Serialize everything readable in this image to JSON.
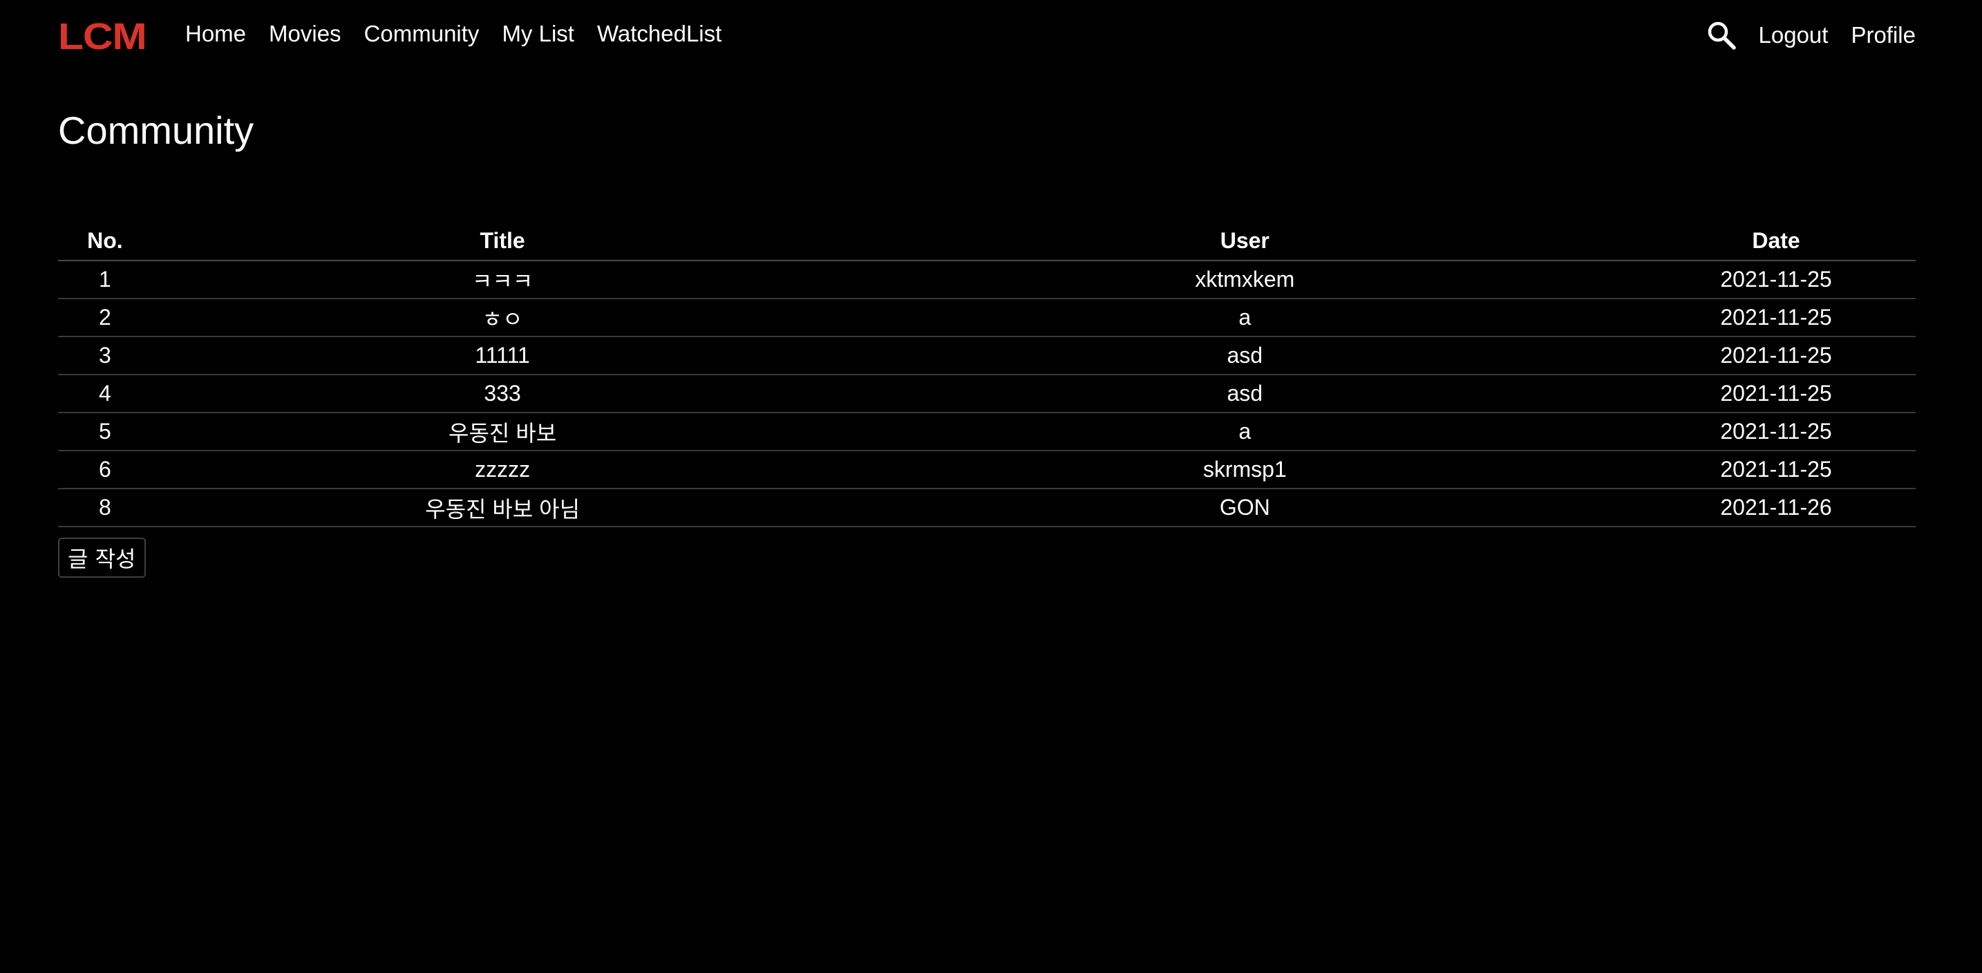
{
  "navbar": {
    "brand": "LCM",
    "links": [
      "Home",
      "Movies",
      "Community",
      "My List",
      "WatchedList"
    ],
    "right_links": [
      "Logout",
      "Profile"
    ],
    "search_icon": "search-icon"
  },
  "page": {
    "title": "Community"
  },
  "table": {
    "headers": [
      "No.",
      "Title",
      "User",
      "Date"
    ],
    "rows": [
      [
        "1",
        "ㅋㅋㅋ",
        "xktmxkem",
        "2021-11-25"
      ],
      [
        "2",
        "ㅎㅇ",
        "a",
        "2021-11-25"
      ],
      [
        "3",
        "11111",
        "asd",
        "2021-11-25"
      ],
      [
        "4",
        "333",
        "asd",
        "2021-11-25"
      ],
      [
        "5",
        "우동진 바보",
        "a",
        "2021-11-25"
      ],
      [
        "6",
        "zzzzz",
        "skrmsp1",
        "2021-11-25"
      ],
      [
        "8",
        "우동진 바보 아님",
        "GON",
        "2021-11-26"
      ]
    ]
  },
  "actions": {
    "write_label": "글 작성"
  },
  "colors": {
    "background": "#000000",
    "brand": "#d9342b",
    "text": "#ffffff"
  }
}
